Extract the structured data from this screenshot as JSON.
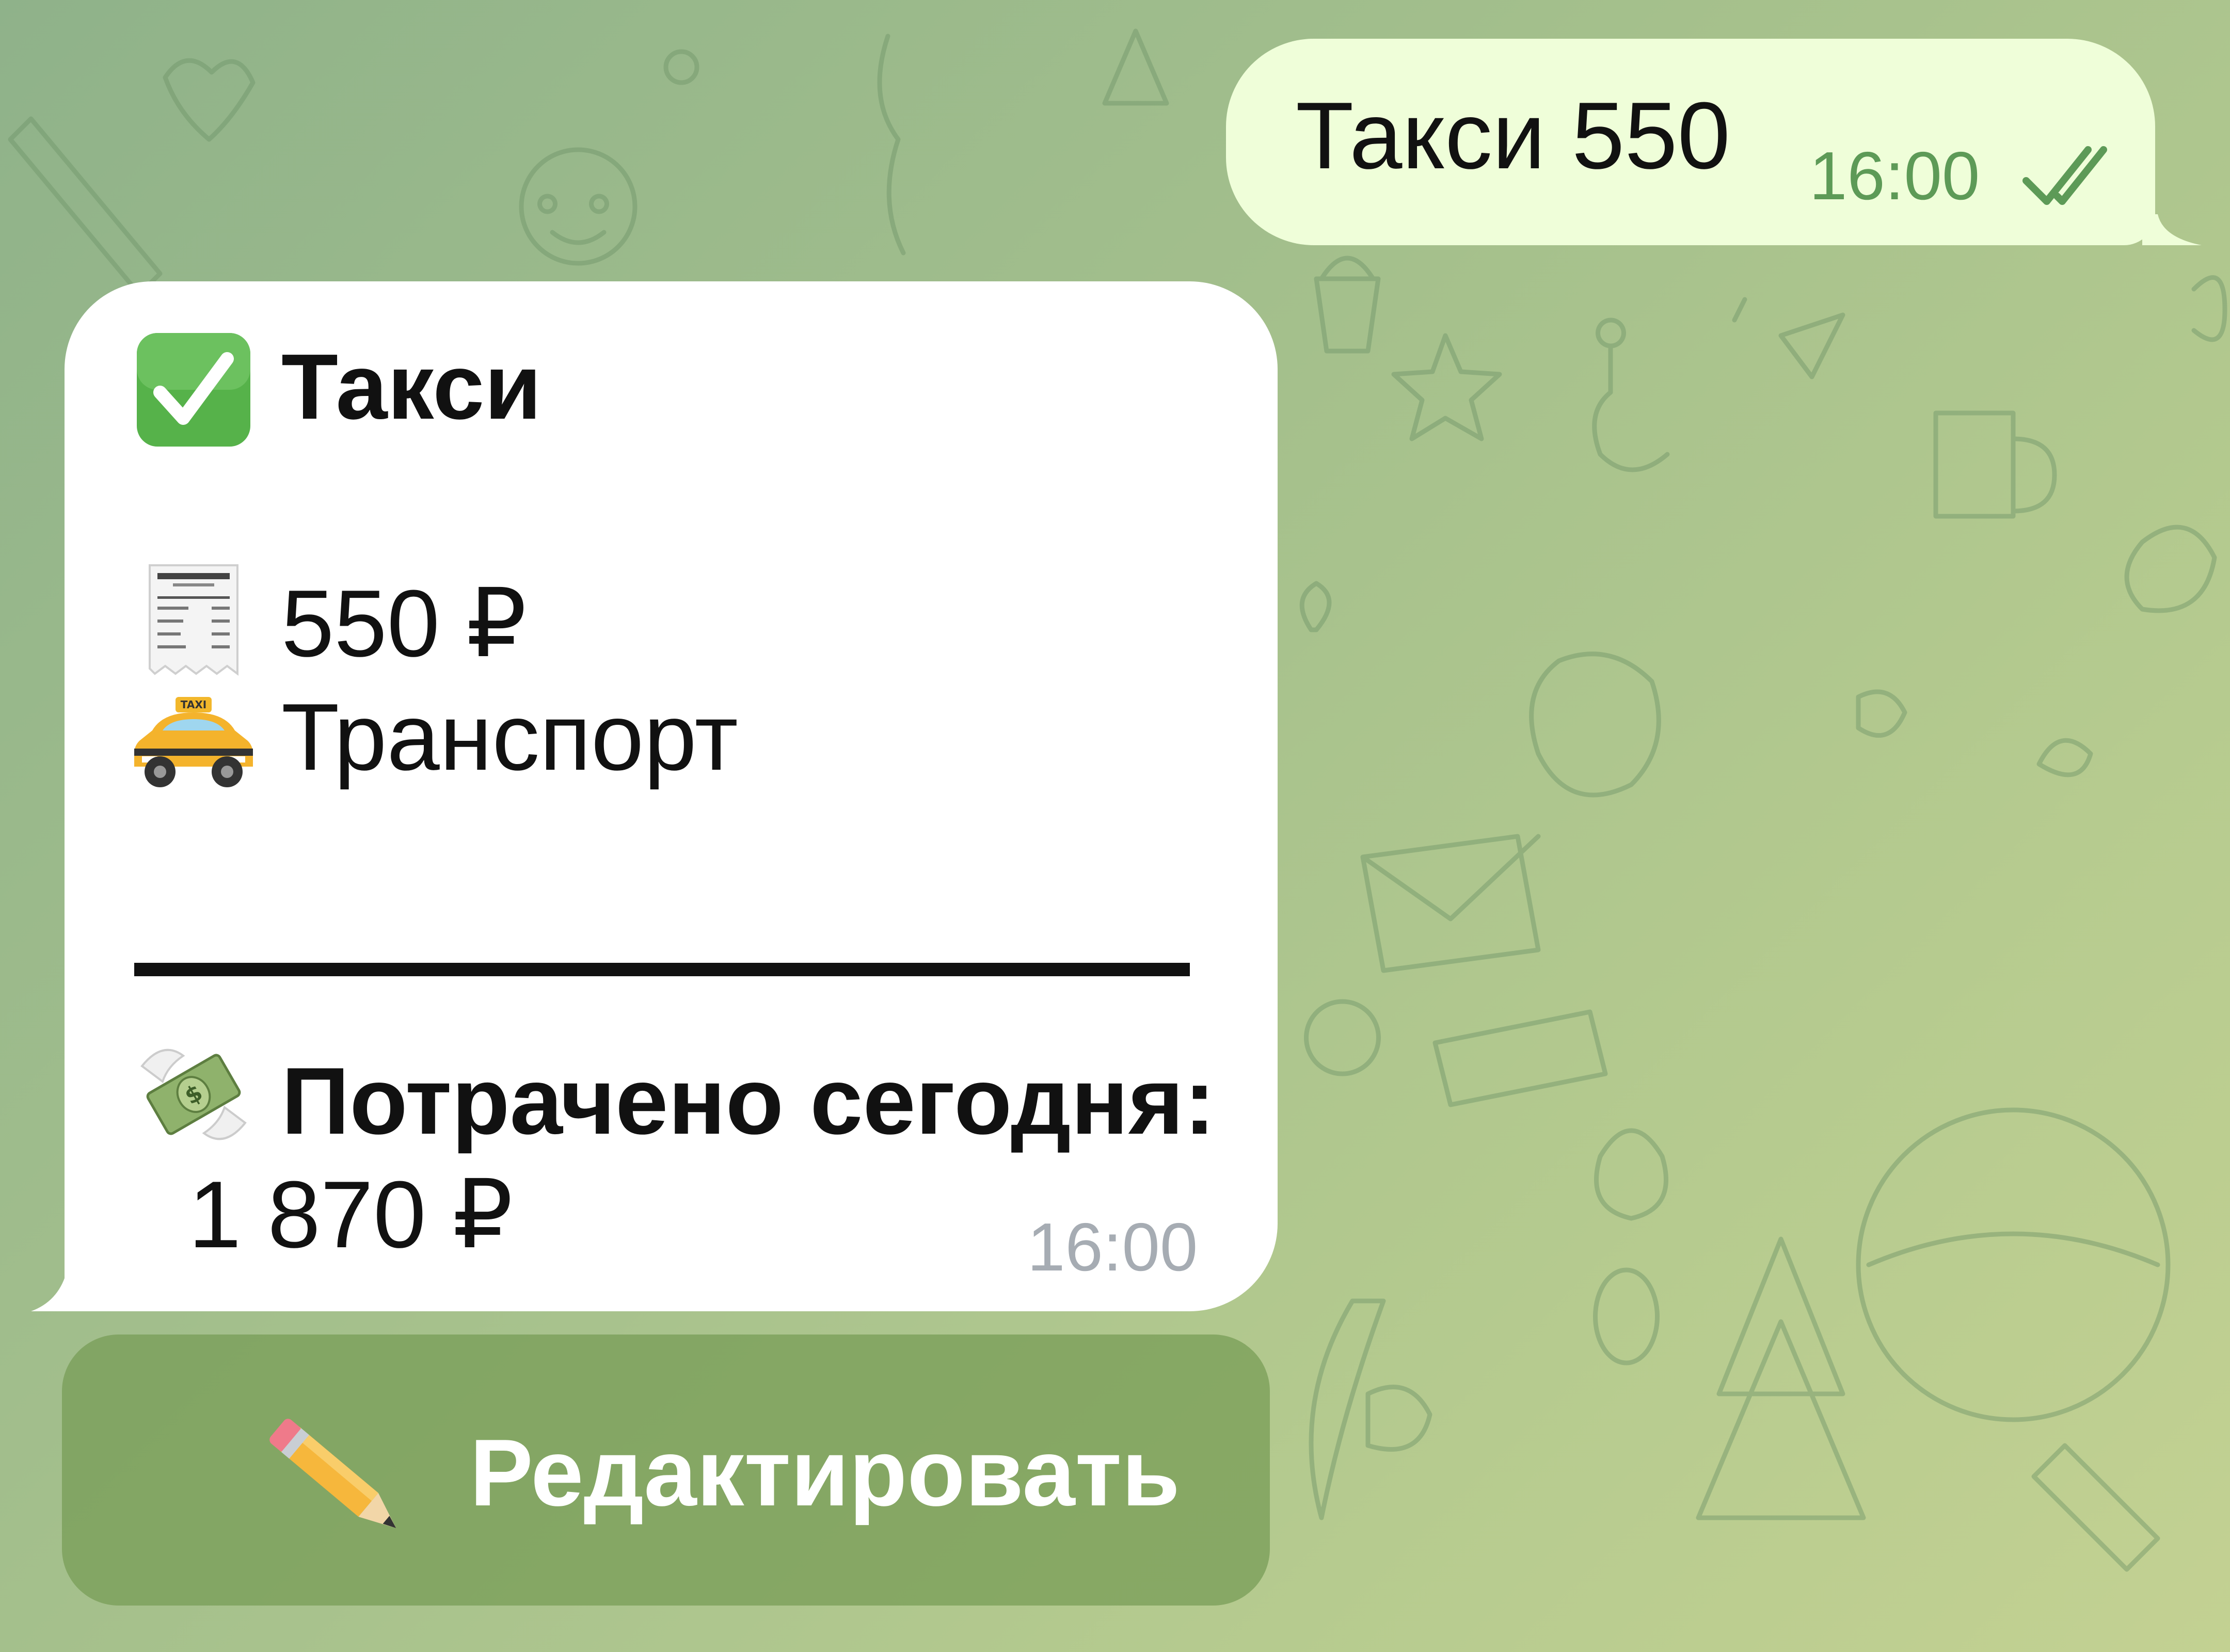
{
  "chat": {
    "outgoing_message": {
      "text": "Такси 550",
      "time": "16:00",
      "status_icon": "double-check-read-icon"
    },
    "bot_message": {
      "title_icon": "check-mark-button-icon",
      "title": "Такси",
      "amount_icon": "receipt-icon",
      "amount": "550 ₽",
      "category_icon": "taxi-icon",
      "category": "Транспорт",
      "spent_icon": "money-with-wings-icon",
      "spent_label": "Потрачено сегодня:",
      "spent_value": "1 870 ₽",
      "time": "16:00"
    },
    "inline_button": {
      "icon": "pencil-icon",
      "label": "Редактировать"
    }
  },
  "colors": {
    "outgoing_bubble": "#effed9",
    "incoming_bubble": "#ffffff",
    "outgoing_time": "#5d9a57",
    "incoming_time": "#a6acb3",
    "inline_button": "#769b54",
    "wallpaper": "#a3bf8c"
  }
}
